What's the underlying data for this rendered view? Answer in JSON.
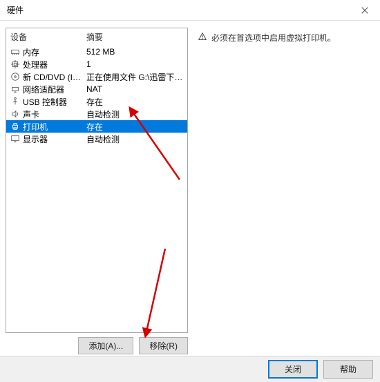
{
  "title": "硬件",
  "headers": {
    "device": "设备",
    "summary": "摘要"
  },
  "devices": [
    {
      "icon": "memory",
      "name": "内存",
      "summary": "512 MB",
      "selected": false
    },
    {
      "icon": "cpu",
      "name": "处理器",
      "summary": "1",
      "selected": false
    },
    {
      "icon": "disc",
      "name": "新 CD/DVD (IDE)",
      "summary": "正在使用文件 G:\\迅雷下载\\kali-l...",
      "selected": false
    },
    {
      "icon": "network",
      "name": "网络适配器",
      "summary": "NAT",
      "selected": false
    },
    {
      "icon": "usb",
      "name": "USB 控制器",
      "summary": "存在",
      "selected": false
    },
    {
      "icon": "sound",
      "name": "声卡",
      "summary": "自动检测",
      "selected": false
    },
    {
      "icon": "printer",
      "name": "打印机",
      "summary": "存在",
      "selected": true
    },
    {
      "icon": "display",
      "name": "显示器",
      "summary": "自动检测",
      "selected": false
    }
  ],
  "buttons": {
    "add": "添加(A)...",
    "remove": "移除(R)"
  },
  "warning": "必须在首选项中启用虚拟打印机。",
  "footer": {
    "close": "关闭",
    "help": "帮助"
  }
}
